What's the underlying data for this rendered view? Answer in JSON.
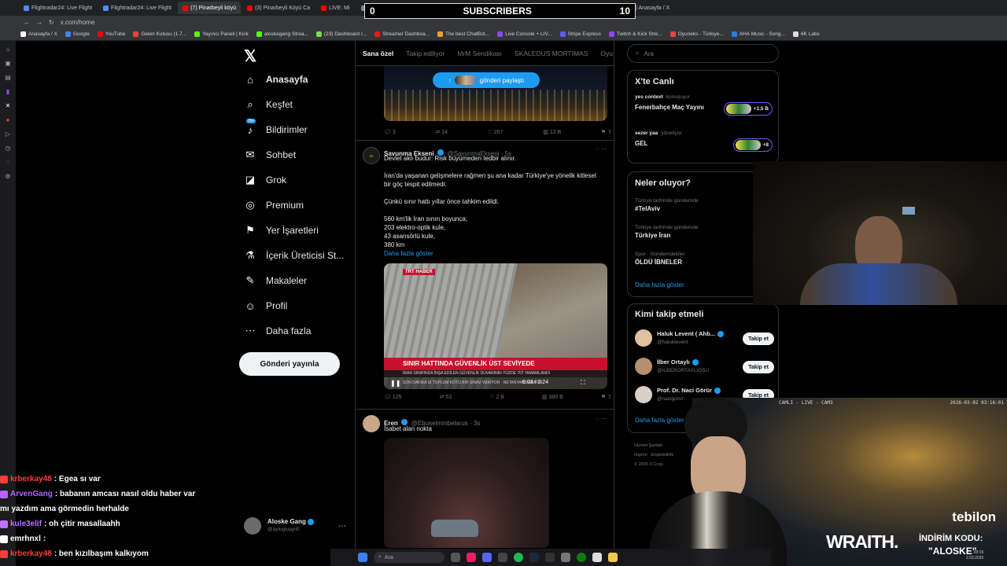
{
  "browser": {
    "tabs": [
      {
        "label": "Flightradar24: Live Flight",
        "color": "#4c8bf5"
      },
      {
        "label": "Flightradar24: Live Flight",
        "color": "#4c8bf5"
      },
      {
        "label": "(7) Pinarbeyli köyü",
        "color": "#ff0000",
        "active": true
      },
      {
        "label": "(3) Pinarbeyli Köyü Ca",
        "color": "#ff0000"
      },
      {
        "label": "LIVE: Mi",
        "color": "#ff0000"
      },
      {
        "label": "East real-tim",
        "color": "#888888"
      },
      {
        "label": "Flightradar24: Live Fl",
        "color": "#4c8bf5"
      },
      {
        "label": "English - Tzofar - Red A",
        "color": "#d93025"
      },
      {
        "label": "(18) Anasayfa / X",
        "color": "#ffffff"
      },
      {
        "label": "(17) Anasayfa / X",
        "color": "#ffffff"
      }
    ],
    "url": "x.com/home",
    "bookmarks": [
      {
        "label": "Anasayfa / X",
        "color": "#ffffff"
      },
      {
        "label": "Google",
        "color": "#4285f4"
      },
      {
        "label": "YouTube",
        "color": "#ff0000"
      },
      {
        "label": "Gelen Kutusu (1.7...",
        "color": "#ea4335"
      },
      {
        "label": "Yayıncı Paneli | Kick",
        "color": "#53fc18"
      },
      {
        "label": "aloskegang Strea...",
        "color": "#53fc18"
      },
      {
        "label": "(23) Dashboard /...",
        "color": "#7ed957"
      },
      {
        "label": "Streamer Dashboa...",
        "color": "#e91916"
      },
      {
        "label": "The best ChatBot...",
        "color": "#f0a020"
      },
      {
        "label": "Live Console + LIV...",
        "color": "#9146ff"
      },
      {
        "label": "Stripe Express",
        "color": "#635bff"
      },
      {
        "label": "Twitch & Kick Stre...",
        "color": "#9146ff"
      },
      {
        "label": "Oyuneks - Türkiye...",
        "color": "#f04040"
      },
      {
        "label": "AHA Music - Song...",
        "color": "#2a7de1"
      },
      {
        "label": "6K Labs",
        "color": "#dddddd"
      }
    ]
  },
  "nav": {
    "items": [
      {
        "label": "Anasayfa",
        "icon": "home-icon",
        "glyph": "⌂"
      },
      {
        "label": "Keşfet",
        "icon": "search-icon",
        "glyph": "⌕"
      },
      {
        "label": "Bildirimler",
        "icon": "bell-icon",
        "glyph": "♪",
        "badge": "20+"
      },
      {
        "label": "Sohbet",
        "icon": "mail-icon",
        "glyph": "✉"
      },
      {
        "label": "Grok",
        "icon": "grok-icon",
        "glyph": "◪"
      },
      {
        "label": "Premium",
        "icon": "premium-icon",
        "glyph": "◎"
      },
      {
        "label": "Yer İşaretleri",
        "icon": "bookmark-icon",
        "glyph": "⚑"
      },
      {
        "label": "İçerik Üreticisi St...",
        "icon": "flask-icon",
        "glyph": "⚗"
      },
      {
        "label": "Makaleler",
        "icon": "article-icon",
        "glyph": "✎"
      },
      {
        "label": "Profil",
        "icon": "profile-icon",
        "glyph": "☺"
      },
      {
        "label": "Daha fazla",
        "icon": "more-icon",
        "glyph": "⋯"
      }
    ],
    "post_button": "Gönderi yayınla",
    "account_name": "Aloske Gang",
    "account_handle": "@aylogluayil0"
  },
  "feed": {
    "tabs": [
      "Sana özel",
      "Takip ediliyor",
      "MrM Sendikası",
      "SKALEDUS MORTIMAS",
      "Oyu"
    ],
    "new_posts": "gönderi paylaştı",
    "tweet0": {
      "replies": "3",
      "retweets": "14",
      "likes": "267",
      "views": "12 B"
    },
    "tweet1": {
      "name": "Savunma Ekseni",
      "handle": "@SavunmaEkseni · 5s",
      "lines": [
        "Devlet aklı budur: Risk büyümeden tedbir alınır.",
        "",
        "İran'da yaşanan gelişmelere rağmen şu ana kadar Türkiye'ye yönelik kitlesel",
        "bir göç tespit edilmedi.",
        "",
        "Çünkü sınır hattı yıllar önce tahkim edildi.",
        "",
        "560 km'lik İran sınırı boyunca;",
        "203 elektro-optik kule,",
        "43 asansörlü kule,",
        "380 km"
      ],
      "show_more": "Daha fazla göster",
      "media_logo": "TRT HABER",
      "media_headline": "SINIR HATTINDA GÜVENLİK ÜST SEVİYEDE",
      "media_sub": "İRAN SINIRINDA İNŞA EDİLEN GÜVENLİK DUVARININ YÜZDE 70'İ TAMAMLANDI",
      "media_ticker": "SON DAKİKA  SI TOPLUM KÖTÜ BİR SINAV VERİYOR · NETANYAHU ARAYIN",
      "media_time": "0:03 / 2:24",
      "replies": "125",
      "retweets": "53",
      "likes": "2 B",
      "views": "380 B"
    },
    "tweet2": {
      "name": "Eren",
      "handle": "@Ebuselmmbelarus · 3s",
      "text": "İsabet alan nokta"
    }
  },
  "right": {
    "search_placeholder": "Ara",
    "live": {
      "title": "X'te Canlı",
      "items": [
        {
          "user": "yes context",
          "status": "konuşuyor",
          "title": "Fenerbahçe Maç Yayını",
          "count": "+1,5 B"
        },
        {
          "user": "sezer yaa",
          "status": "yönetiyor",
          "title": "GEL",
          "count": "+8"
        }
      ]
    },
    "trends": {
      "title": "Neler oluyor?",
      "items": [
        {
          "context": "Türkiye tarihinde gündemde",
          "topic": "#TelAviv"
        },
        {
          "context": "Türkiye tarihinde gündemde",
          "topic": "Türkiye İran"
        },
        {
          "context": "Spor · Gündemdekiler",
          "topic": "ÖLDÜ İBNELER"
        }
      ],
      "more": "Daha fazla göster"
    },
    "follow": {
      "title": "Kimi takip etmeli",
      "items": [
        {
          "name": "Haluk Levent ( Ahb...",
          "handle": "@haluklevent"
        },
        {
          "name": "İlber Ortaylı",
          "handle": "@ILBERORTAYLIGSU"
        },
        {
          "name": "Prof. Dr. Naci Görür",
          "handle": "@nacigorur"
        }
      ],
      "button": "Takip et",
      "more": "Daha fazla göster"
    },
    "footer": {
      "line1": "Hizmet Şartları",
      "line2a": "Imprint",
      "line2b": "Erişilebilirlik",
      "line3": "© 2026 X Corp."
    }
  },
  "overlay": {
    "subs_left": "0",
    "subs_label": "SUBSCRIBERS",
    "subs_right": "10",
    "cam_label": "CAMLI - LIVE - CAM3",
    "cam_time": "2026-03-02 03:16:01",
    "brand": "tebilon",
    "sponsor": "WRAITH.",
    "promo_label": "İNDİRİM KODU:",
    "promo_code": "\"ALOSKE\"",
    "clock": "03:16",
    "date": "2.03.2026",
    "taskbar_search": "Ara"
  },
  "chat": [
    {
      "user": "krberkay48",
      "color": "#ff3b3b",
      "msg": ": Egea sı var"
    },
    {
      "user": "ArvenGang",
      "color": "#b266ff",
      "msg": ": babanın amcası nasıl oldu haber var"
    },
    {
      "user": "",
      "color": "#ffffff",
      "msg": "mı yazdım ama görmedin herhalde"
    },
    {
      "user": "kule3elif",
      "color": "#c070ff",
      "msg": ": oh çitir masallaahh"
    },
    {
      "user": "emrhnxl",
      "color": "#ffffff",
      "msg": ":"
    },
    {
      "user": "krberkay48",
      "color": "#ff3b3b",
      "msg": ": ben kızılbaşım kalkıyom"
    }
  ]
}
